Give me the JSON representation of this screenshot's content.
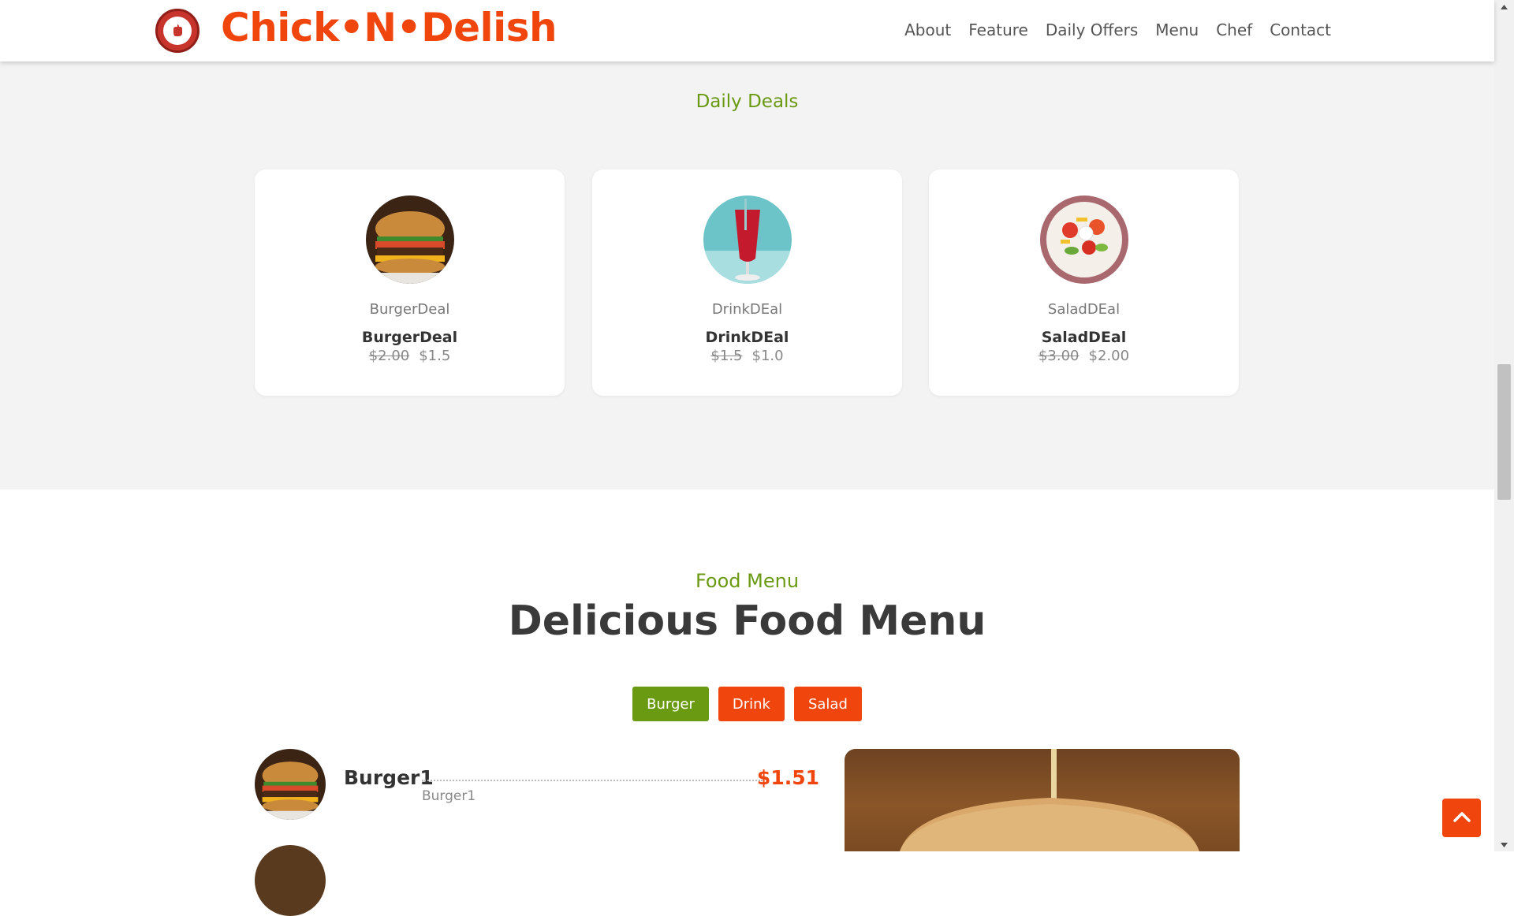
{
  "brand": {
    "name": "Chick•N•Delish",
    "logo_text": "Chick'N'Delish"
  },
  "nav": {
    "items": [
      {
        "label": "About"
      },
      {
        "label": "Feature"
      },
      {
        "label": "Daily Offers"
      },
      {
        "label": "Menu"
      },
      {
        "label": "Chef"
      },
      {
        "label": "Contact"
      }
    ]
  },
  "deals": {
    "subtitle": "Daily Deals",
    "cards": [
      {
        "category": "BurgerDeal",
        "name": "BurgerDeal",
        "old_price": "$2.00",
        "price": "$1.5",
        "image": "burger"
      },
      {
        "category": "DrinkDEal",
        "name": "DrinkDEal",
        "old_price": "$1.5",
        "price": "$1.0",
        "image": "drink"
      },
      {
        "category": "SaladDEal",
        "name": "SaladDEal",
        "old_price": "$3.00",
        "price": "$2.00",
        "image": "salad"
      }
    ]
  },
  "menu": {
    "subtitle": "Food Menu",
    "title": "Delicious Food Menu",
    "filters": [
      {
        "label": "Burger",
        "active": true
      },
      {
        "label": "Drink",
        "active": false
      },
      {
        "label": "Salad",
        "active": false
      }
    ],
    "items": [
      {
        "name": "Burger1",
        "description": "Burger1",
        "price": "$1.51"
      }
    ]
  },
  "colors": {
    "accent": "#f0460e",
    "green": "#6a9a12",
    "section_bg": "#f3f3f3"
  },
  "icons": {
    "scroll_top": "chevron-up-icon"
  }
}
